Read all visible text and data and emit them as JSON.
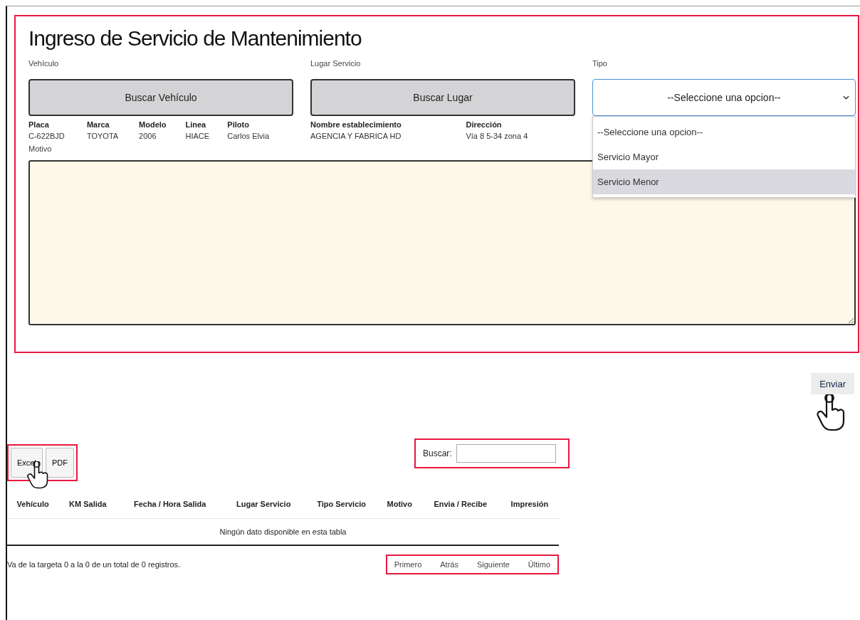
{
  "form": {
    "title": "Ingreso de Servicio de Mantenimiento",
    "vehiculo": {
      "label": "Vehículo",
      "button": "Buscar Vehículo",
      "columns": [
        "Placa",
        "Marca",
        "Modelo",
        "Linea",
        "Piloto"
      ],
      "values": [
        "C-622BJD",
        "TOYOTA",
        "2006",
        "HIACE",
        "Carlos Elvia"
      ]
    },
    "lugar": {
      "label": "Lugar Servicio",
      "button": "Buscar Lugar",
      "columns": [
        "Nombre establecimiento",
        "Dirección"
      ],
      "values": [
        "AGENCIA Y FABRICA HD",
        "Vía 8 5-34 zona 4"
      ]
    },
    "tipo": {
      "label": "Tipo",
      "value": "--Seleccione una opcion--",
      "expanded": true,
      "options": [
        {
          "label": "--Seleccione una opcion--",
          "highlighted": false
        },
        {
          "label": "Servicio Mayor",
          "highlighted": false
        },
        {
          "label": "Servicio Menor",
          "highlighted": true
        }
      ]
    },
    "motivo": {
      "label": "Motivo"
    }
  },
  "submit": "Enviar",
  "export_buttons": [
    "Excel",
    "PDF"
  ],
  "search": {
    "label": "Buscar:"
  },
  "table": {
    "columns": [
      "Vehículo",
      "KM Salida",
      "Fecha / Hora Salida",
      "Lugar Servicio",
      "Tipo Servicio",
      "Motivo",
      "Envia / Recibe",
      "Impresión"
    ],
    "empty": "Ningún dato disponible en esta tabla"
  },
  "footer": {
    "info": "Va de la targeta 0 a la 0 de un total de 0 registros.",
    "pagination": [
      "Primero",
      "Atrás",
      "Siguiente",
      "Último"
    ]
  }
}
